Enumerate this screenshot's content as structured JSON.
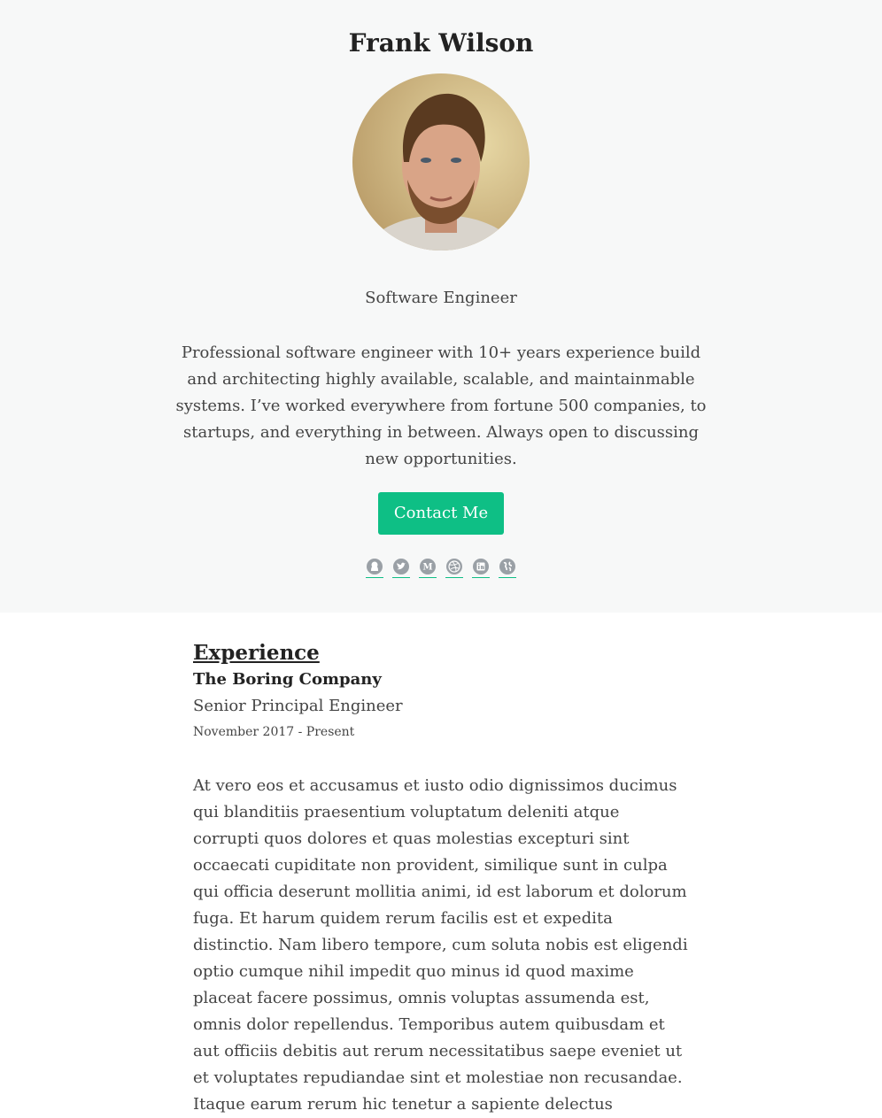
{
  "profile": {
    "name": "Frank Wilson",
    "role": "Software Engineer",
    "bio": "Professional software engineer with 10+ years experience build and architecting highly available, scalable, and maintainmable systems. I’ve worked everywhere from fortune 500 companies, to startups, and everything in between. Always open to discussing new opportunities.",
    "contact_label": "Contact Me"
  },
  "social_icons": [
    "github-icon",
    "twitter-icon",
    "medium-icon",
    "dribbble-icon",
    "linkedin-icon",
    "globe-icon"
  ],
  "colors": {
    "accent": "#0ebf85",
    "hero_bg": "#f7f8f8",
    "icon": "#9aa0a6"
  },
  "experience": {
    "heading": "Experience",
    "items": [
      {
        "company": "The Boring Company",
        "title": "Senior Principal Engineer",
        "dates": "November 2017 - Present",
        "description": "At vero eos et accusamus et iusto odio dignissimos ducimus qui blanditiis praesentium voluptatum deleniti atque corrupti quos dolores et quas molestias excepturi sint occaecati cupiditate non provident, similique sunt in culpa qui officia deserunt mollitia animi, id est laborum et dolorum fuga. Et harum quidem rerum facilis est et expedita distinctio. Nam libero tempore, cum soluta nobis est eligendi optio cumque nihil impedit quo minus id quod maxime placeat facere possimus, omnis voluptas assumenda est, omnis dolor repellendus. Temporibus autem quibusdam et aut officiis debitis aut rerum necessitatibus saepe eveniet ut et voluptates repudiandae sint et molestiae non recusandae. Itaque earum rerum hic tenetur a sapiente delectus"
      }
    ]
  }
}
